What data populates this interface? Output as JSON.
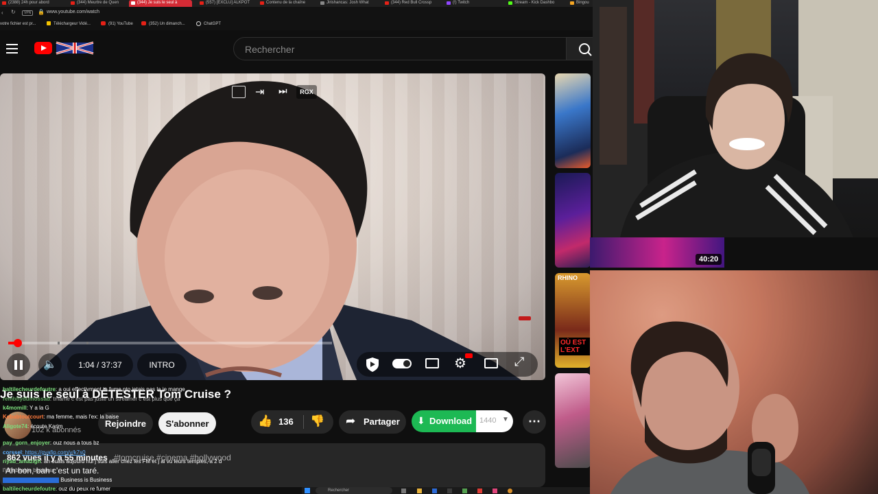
{
  "browser": {
    "tabs": [
      {
        "label": "(2388) 24h pour abord"
      },
      {
        "label": "(344) Meurtre de Quen"
      },
      {
        "label": "(344) Je suis le seul à",
        "active": true
      },
      {
        "label": "(557) [EXCLU] ALKPOT"
      },
      {
        "label": "Contenu de la chaîne"
      },
      {
        "label": "Jirishancas: Josh What"
      },
      {
        "label": "(344) Red Bull Crossp"
      },
      {
        "label": "(!) Twitch"
      },
      {
        "label": "Stream - Kick Dashbo"
      },
      {
        "label": "Bingou"
      }
    ],
    "vpn_badge": "VPN",
    "url": "www.youtube.com/watch",
    "bookmarks": [
      {
        "label": "votre fichier est pr..."
      },
      {
        "label": "Téléchargeur Vidé..."
      },
      {
        "label": "(91) YouTube"
      },
      {
        "label": "(352) Un dimanch..."
      },
      {
        "label": "ChatGPT"
      }
    ]
  },
  "header": {
    "search_placeholder": "Rechercher"
  },
  "player": {
    "time": "1:04 / 37:37",
    "chapter": "INTRO",
    "top_actions": [
      "RGX"
    ],
    "progress": 0.03
  },
  "sidebar": {
    "duration_badge": "40:20",
    "thumb_text": "OÙ EST L'EXT",
    "thumb_brand": "RHINO"
  },
  "video": {
    "title": "Je suis le seul à DÉTESTER Tom Cruise ?",
    "subscribers": "102 k abonnés",
    "join_label": "Rejoindre",
    "subscribe_label": "S'abonner",
    "like_count": "136",
    "share_label": "Partager",
    "download_label": "Download",
    "download_count": "1440",
    "views": "862 vues  il y a 55 minutes",
    "hashtags": "#tomcruise #cinema #hollywood",
    "description": "Ah bon, bah c'est un taré."
  },
  "chat": [
    {
      "user": "baltilecheurdefoutre",
      "msg": ": a oui effectivment ta fume pto jetais pas la je mange"
    },
    {
      "user": "rembbydumossad",
      "msg": ": tmame c est pas juste un streamer c est plus que ça"
    },
    {
      "user": "k4momill",
      "msg": ": Y a la G"
    },
    {
      "user": "Kebabtoutcourt",
      "msg": ": ma femme, mais l'ex: la baise"
    },
    {
      "user": "Aligote74",
      "msg": ": écoute Karim"
    },
    {
      "user": "pay_gorn_enjoyer",
      "msg": ": ouz nous a tous bz"
    },
    {
      "user": "corssel",
      "msg": ": https://gyafip.com/v/k7s0"
    },
    {
      "user": "riyad_amazigh",
      "msg": ": ah ouais aujourd hui j suis aller chez les FM et j ai vu leurs temples, a 2 d"
    },
    {
      "user": "",
      "msg": "l'inhabitable business"
    },
    {
      "user": "",
      "msg": "Business is Business"
    },
    {
      "user": "baltilecheurdefoutre",
      "msg": ": ouz du peux re fumer"
    }
  ],
  "taskbar": {
    "search_placeholder": "Rechercher"
  },
  "colors": {
    "youtube_red": "#ff0000",
    "download_green": "#1db954",
    "chat_user_green": "#7ee07e"
  }
}
